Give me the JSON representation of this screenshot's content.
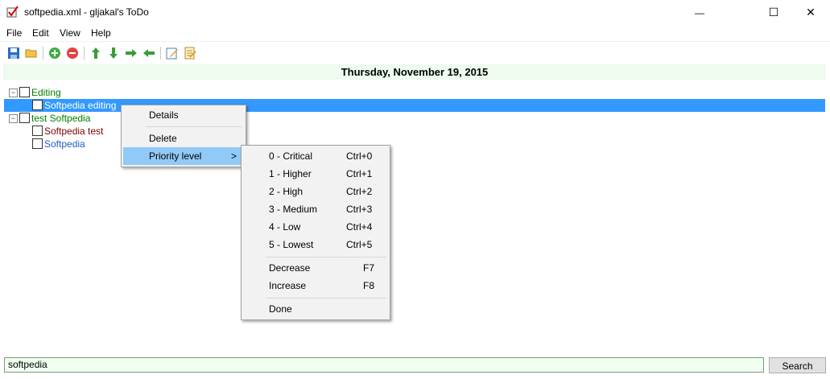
{
  "window": {
    "title": "softpedia.xml - gljakal's ToDo",
    "minimize_glyph": "—",
    "maximize_glyph": "☐",
    "close_glyph": "✕"
  },
  "menu": {
    "file": "File",
    "edit": "Edit",
    "view": "View",
    "help": "Help"
  },
  "toolbar": {
    "icons": [
      "save-icon",
      "open-folder-icon",
      "add-icon",
      "remove-icon",
      "move-up-icon",
      "move-down-icon",
      "indent-icon",
      "outdent-icon",
      "edit-icon",
      "notes-icon"
    ]
  },
  "date_header": "Thursday, November 19, 2015",
  "tree": {
    "groups": [
      {
        "label": "Editing",
        "color": "#008000",
        "expander": "−",
        "items": [
          {
            "label": "Softpedia editing",
            "color": "#ffffff",
            "selected": true
          }
        ]
      },
      {
        "label": "test Softpedia",
        "color": "#008000",
        "expander": "−",
        "items": [
          {
            "label": "Softpedia test",
            "color": "#800000"
          },
          {
            "label": "Softpedia",
            "color": "#1f5fbf"
          }
        ]
      }
    ]
  },
  "context_menu": {
    "details": "Details",
    "delete": "Delete",
    "priority_level": "Priority level",
    "submenu_arrow": ">"
  },
  "priority_submenu": {
    "items": [
      {
        "label": "0 - Critical",
        "shortcut": "Ctrl+0"
      },
      {
        "label": "1 - Higher",
        "shortcut": "Ctrl+1"
      },
      {
        "label": "2 - High",
        "shortcut": "Ctrl+2"
      },
      {
        "label": "3 - Medium",
        "shortcut": "Ctrl+3"
      },
      {
        "label": "4 - Low",
        "shortcut": "Ctrl+4"
      },
      {
        "label": "5 - Lowest",
        "shortcut": "Ctrl+5"
      }
    ],
    "decrease": {
      "label": "Decrease",
      "shortcut": "F7"
    },
    "increase": {
      "label": "Increase",
      "shortcut": "F8"
    },
    "done": "Done"
  },
  "search": {
    "value": "softpedia",
    "button": "Search"
  },
  "colors": {
    "selection": "#3399ff",
    "menu_highlight": "#91c9f7",
    "date_bar": "#eefbee"
  }
}
